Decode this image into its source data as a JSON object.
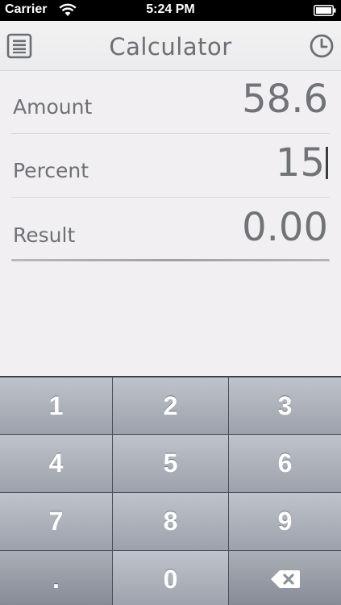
{
  "status_bar": {
    "carrier": "Carrier",
    "time": "5:24 PM",
    "wifi_icon": "wifi-icon",
    "battery_icon": "battery-icon"
  },
  "navbar": {
    "title": "Calculator",
    "menu_icon": "menu-icon",
    "history_icon": "clock-icon"
  },
  "fields": {
    "amount": {
      "label": "Amount",
      "value": "58.6"
    },
    "percent": {
      "label": "Percent",
      "value": "15"
    },
    "result": {
      "label": "Result",
      "value": "0.00"
    }
  },
  "keypad": {
    "keys": [
      "1",
      "2",
      "3",
      "4",
      "5",
      "6",
      "7",
      "8",
      "9",
      ".",
      "0"
    ],
    "backspace_icon": "backspace-icon"
  },
  "colors": {
    "app_background": "#f1eff1",
    "text_gray": "#6e7176",
    "keypad_key": "#b4b8c0",
    "keypad_dark_key": "#9a9fa8"
  }
}
